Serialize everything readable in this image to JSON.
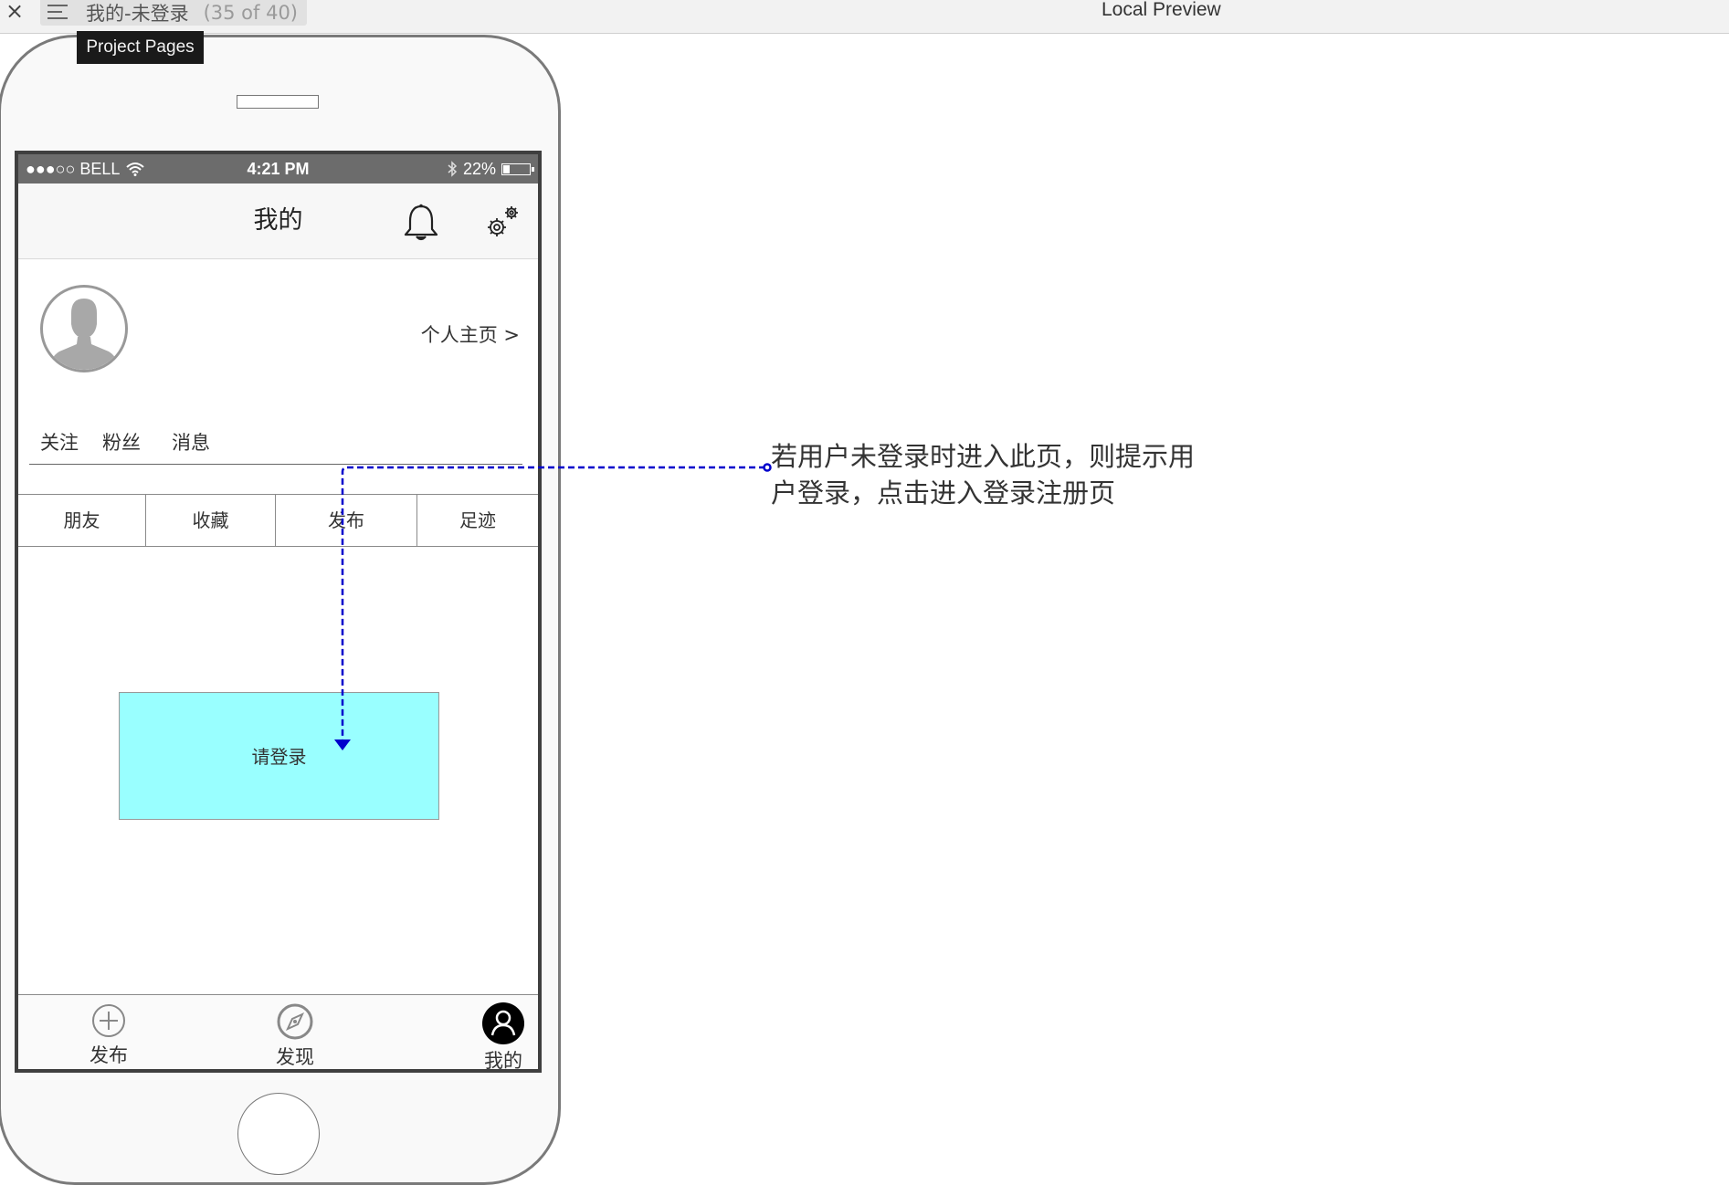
{
  "window": {
    "close_glyph": "×",
    "tab_title": "我的-未登录",
    "tab_count": "(35 of 40)",
    "preview_label": "Local Preview",
    "tooltip": "Project Pages"
  },
  "statusbar": {
    "carrier": "●●●○○ BELL",
    "time": "4:21 PM",
    "battery": "22%",
    "battery_level": 0.22
  },
  "navbar": {
    "title": "我的",
    "icons": [
      "bell-icon",
      "gear-icon"
    ]
  },
  "profile": {
    "homepage_link": "个人主页 >",
    "stats": [
      "关注",
      "粉丝",
      "消息"
    ],
    "tabs": [
      "朋友",
      "收藏",
      "发布",
      "足迹"
    ]
  },
  "login": {
    "label": "请登录",
    "bg_color": "#99ffff"
  },
  "tabbar": {
    "items": [
      {
        "label": "发布",
        "icon": "plus-circle-icon"
      },
      {
        "label": "发现",
        "icon": "compass-icon"
      },
      {
        "label": "我的",
        "icon": "user-icon"
      }
    ]
  },
  "annotation": {
    "text": "若用户未登录时进入此页，则提示用户登录，点击进入登录注册页",
    "color": "#0000cc"
  }
}
